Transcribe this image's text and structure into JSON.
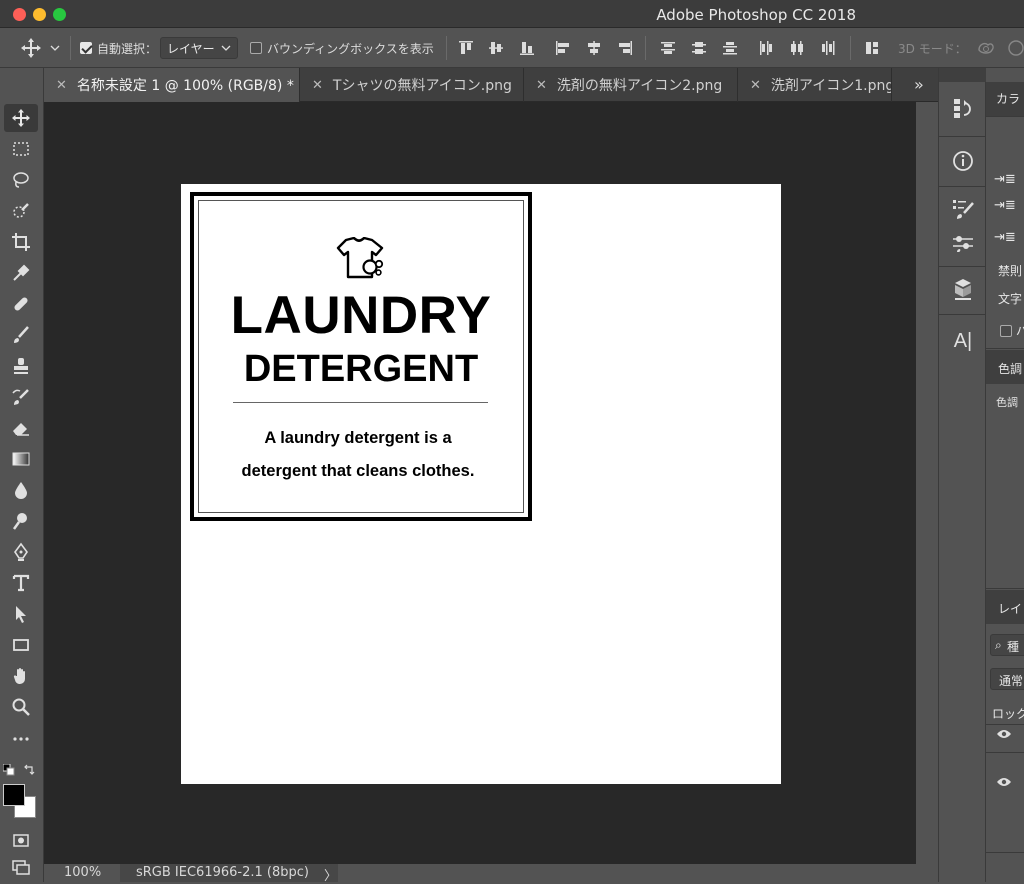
{
  "window": {
    "app_title": "Adobe Photoshop CC 2018"
  },
  "options": {
    "auto_select_label": "自動選択：",
    "auto_select_target": "レイヤー",
    "bounding_box_label": "バウンディングボックスを表示",
    "mode_3d_label": "3D モード："
  },
  "tabs": [
    {
      "label": "名称未設定 1 @ 100% (RGB/8) *",
      "active": true
    },
    {
      "label": "Tシャツの無料アイコン.png",
      "active": false
    },
    {
      "label": "洗剤の無料アイコン2.png",
      "active": false
    },
    {
      "label": "洗剤アイコン1.png",
      "active": false
    }
  ],
  "tabs_overflow": "»",
  "document": {
    "title_line1": "LAUNDRY",
    "title_line2": "DETERGENT",
    "description_line1": "A laundry detergent is a",
    "description_line2": "detergent that cleans clothes.",
    "icon": "t-shirt-with-bubbles-icon"
  },
  "status": {
    "zoom": "100%",
    "color_profile": "sRGB IEC61966-2.1 (8bpc)",
    "arrow": "〉"
  },
  "right_panel": {
    "color_tab": "カラ",
    "kinsoku_label": "禁則",
    "moji_label": "文字",
    "checkbox_label": "バ",
    "adjust_label": "色調",
    "adjust_sub": "色調",
    "layers_tab": "レイ",
    "search_kind": "種",
    "blend_mode": "通常",
    "lock_label": "ロック"
  },
  "dock": {
    "text_icon_label": "A|"
  }
}
